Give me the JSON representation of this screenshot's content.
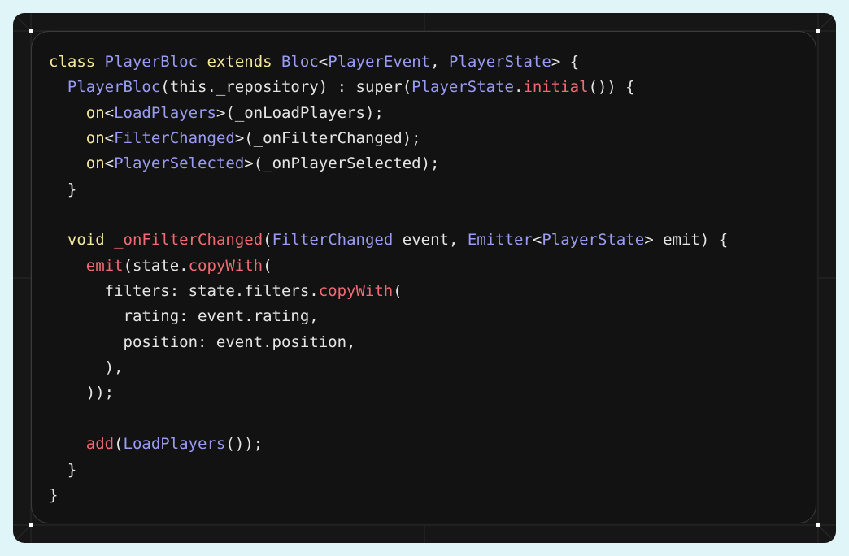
{
  "colors": {
    "keyword": "#f4e89a",
    "type": "#9a9cf4",
    "function": "#f06b73",
    "plain": "#e6e6e6",
    "background": "#121212",
    "frame": "#e0f5f8"
  },
  "code_lines": [
    [
      [
        "kw",
        "class"
      ],
      [
        "p",
        " "
      ],
      [
        "ty",
        "PlayerBloc"
      ],
      [
        "p",
        " "
      ],
      [
        "kw",
        "extends"
      ],
      [
        "p",
        " "
      ],
      [
        "ty",
        "Bloc"
      ],
      [
        "p",
        "<"
      ],
      [
        "ty",
        "PlayerEvent"
      ],
      [
        "p",
        ", "
      ],
      [
        "ty",
        "PlayerState"
      ],
      [
        "p",
        "> {"
      ]
    ],
    [
      [
        "p",
        "  "
      ],
      [
        "ty",
        "PlayerBloc"
      ],
      [
        "p",
        "(this._repository) : super("
      ],
      [
        "ty",
        "PlayerState"
      ],
      [
        "p",
        "."
      ],
      [
        "fn",
        "initial"
      ],
      [
        "p",
        "()) {"
      ]
    ],
    [
      [
        "p",
        "    "
      ],
      [
        "kw",
        "on"
      ],
      [
        "p",
        "<"
      ],
      [
        "ty",
        "LoadPlayers"
      ],
      [
        "p",
        ">(_onLoadPlayers);"
      ]
    ],
    [
      [
        "p",
        "    "
      ],
      [
        "kw",
        "on"
      ],
      [
        "p",
        "<"
      ],
      [
        "ty",
        "FilterChanged"
      ],
      [
        "p",
        ">(_onFilterChanged);"
      ]
    ],
    [
      [
        "p",
        "    "
      ],
      [
        "kw",
        "on"
      ],
      [
        "p",
        "<"
      ],
      [
        "ty",
        "PlayerSelected"
      ],
      [
        "p",
        ">(_onPlayerSelected);"
      ]
    ],
    [
      [
        "p",
        "  }"
      ]
    ],
    [
      [
        "p",
        ""
      ]
    ],
    [
      [
        "p",
        "  "
      ],
      [
        "kw",
        "void"
      ],
      [
        "p",
        " "
      ],
      [
        "fn",
        "_onFilterChanged"
      ],
      [
        "p",
        "("
      ],
      [
        "ty",
        "FilterChanged"
      ],
      [
        "p",
        " event, "
      ],
      [
        "ty",
        "Emitter"
      ],
      [
        "p",
        "<"
      ],
      [
        "ty",
        "PlayerState"
      ],
      [
        "p",
        "> emit) {"
      ]
    ],
    [
      [
        "p",
        "    "
      ],
      [
        "fn",
        "emit"
      ],
      [
        "p",
        "(state."
      ],
      [
        "fn",
        "copyWith"
      ],
      [
        "p",
        "("
      ]
    ],
    [
      [
        "p",
        "      filters: state.filters."
      ],
      [
        "fn",
        "copyWith"
      ],
      [
        "p",
        "("
      ]
    ],
    [
      [
        "p",
        "        rating: event.rating,"
      ]
    ],
    [
      [
        "p",
        "        position: event.position,"
      ]
    ],
    [
      [
        "p",
        "      ),"
      ]
    ],
    [
      [
        "p",
        "    ));"
      ]
    ],
    [
      [
        "p",
        ""
      ]
    ],
    [
      [
        "p",
        "    "
      ],
      [
        "fn",
        "add"
      ],
      [
        "p",
        "("
      ],
      [
        "ty",
        "LoadPlayers"
      ],
      [
        "p",
        "());"
      ]
    ],
    [
      [
        "p",
        "  }"
      ]
    ],
    [
      [
        "p",
        "}"
      ]
    ]
  ]
}
